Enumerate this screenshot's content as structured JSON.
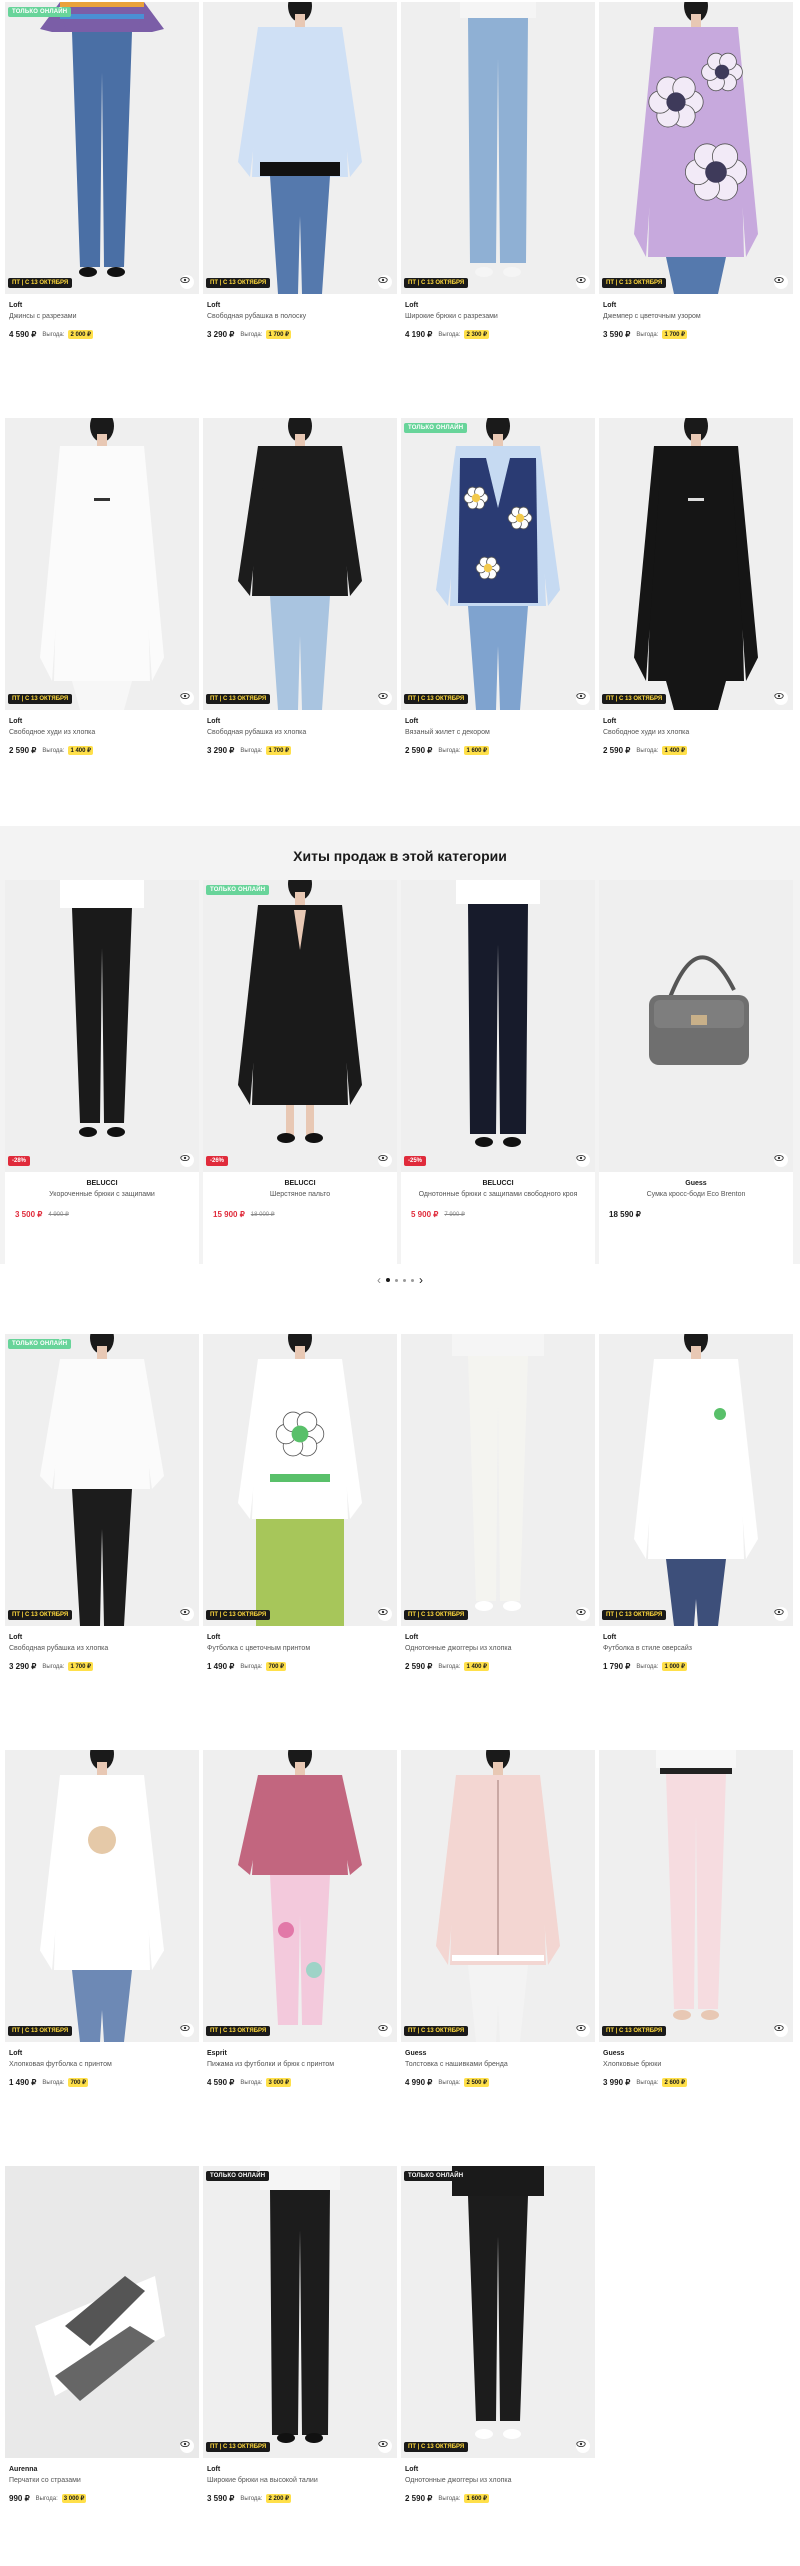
{
  "promo_badge": "ПТ | С 13 ОКТЯБРЯ",
  "online_badge": "ТОЛЬКО ОНЛАЙН",
  "save_label": "Выгода:",
  "hits_title": "Хиты продаж в этой категории",
  "rows": [
    {
      "items": [
        {
          "brand": "Loft",
          "name": "Джинсы с разрезами",
          "price": "4 590 ₽",
          "save": "2 000 ₽",
          "online": "green",
          "img": "jeans"
        },
        {
          "brand": "Loft",
          "name": "Свободная рубашка в полоску",
          "price": "3 290 ₽",
          "save": "1 700 ₽",
          "online": "",
          "img": "shirt"
        },
        {
          "brand": "Loft",
          "name": "Широкие брюки с разрезами",
          "price": "4 190 ₽",
          "save": "2 300 ₽",
          "online": "",
          "img": "widejeans"
        },
        {
          "brand": "Loft",
          "name": "Джемпер с цветочным узором",
          "price": "3 590 ₽",
          "save": "1 700 ₽",
          "online": "",
          "img": "flowers"
        }
      ]
    },
    {
      "items": [
        {
          "brand": "Loft",
          "name": "Свободное худи из хлопка",
          "price": "2 590 ₽",
          "save": "1 400 ₽",
          "online": "",
          "img": "whitehoodie"
        },
        {
          "brand": "Loft",
          "name": "Свободная рубашка из хлопка",
          "price": "3 290 ₽",
          "save": "1 700 ₽",
          "online": "",
          "img": "blackshirt"
        },
        {
          "brand": "Loft",
          "name": "Вязаный жилет с декором",
          "price": "2 590 ₽",
          "save": "1 600 ₽",
          "online": "green",
          "img": "vest"
        },
        {
          "brand": "Loft",
          "name": "Свободное худи из хлопка",
          "price": "2 590 ₽",
          "save": "1 400 ₽",
          "online": "",
          "img": "blackhoodie"
        }
      ]
    },
    {
      "items": [
        {
          "brand": "Loft",
          "name": "Свободная рубашка из хлопка",
          "price": "3 290 ₽",
          "save": "1 700 ₽",
          "online": "green",
          "img": "whiteshirt"
        },
        {
          "brand": "Loft",
          "name": "Футболка с цветочным принтом",
          "price": "1 490 ₽",
          "save": "700 ₽",
          "online": "",
          "img": "flowertee"
        },
        {
          "brand": "Loft",
          "name": "Однотонные джоггеры из хлопка",
          "price": "2 590 ₽",
          "save": "1 400 ₽",
          "online": "",
          "img": "whitejoggers"
        },
        {
          "brand": "Loft",
          "name": "Футболка в стиле оверсайз",
          "price": "1 790 ₽",
          "save": "1 000 ₽",
          "online": "",
          "img": "oversizetee"
        }
      ]
    },
    {
      "items": [
        {
          "brand": "Loft",
          "name": "Хлопковая футболка с принтом",
          "price": "1 490 ₽",
          "save": "700 ₽",
          "online": "",
          "img": "printtee"
        },
        {
          "brand": "Esprit",
          "name": "Пижама из футболки и брюк с принтом",
          "price": "4 590 ₽",
          "save": "3 000 ₽",
          "online": "",
          "img": "pajama"
        },
        {
          "brand": "Guess",
          "name": "Толстовка с нашивками бренда",
          "price": "4 990 ₽",
          "save": "2 500 ₽",
          "online": "",
          "img": "pinkjacket"
        },
        {
          "brand": "Guess",
          "name": "Хлопковые брюки",
          "price": "3 990 ₽",
          "save": "2 600 ₽",
          "online": "",
          "img": "pinkpants"
        }
      ]
    },
    {
      "items": [
        {
          "brand": "Aurenna",
          "name": "Перчатки со стразами",
          "price": "990 ₽",
          "save": "3 000 ₽",
          "online": "",
          "img": "gloves"
        },
        {
          "brand": "Loft",
          "name": "Широкие брюки на высокой талии",
          "price": "3 590 ₽",
          "save": "2 200 ₽",
          "online": "dark",
          "img": "blackpants"
        },
        {
          "brand": "Loft",
          "name": "Однотонные джоггеры из хлопка",
          "price": "2 590 ₽",
          "save": "1 600 ₽",
          "online": "dark",
          "img": "blackjoggers"
        }
      ]
    }
  ],
  "hits": [
    {
      "brand": "BELUCCI",
      "name": "Укороченные брюки с защипами",
      "price": "3 500 ₽",
      "old": "4 900 ₽",
      "disc": "-28%",
      "online": "",
      "img": "hpants1"
    },
    {
      "brand": "BELUCCI",
      "name": "Шерстяное пальто",
      "price": "15 900 ₽",
      "old": "18 000 ₽",
      "disc": "-26%",
      "online": "green",
      "img": "coat"
    },
    {
      "brand": "BELUCCI",
      "name": "Однотонные брюки с защипами свободного кроя",
      "price": "5 900 ₽",
      "old": "7 900 ₽",
      "disc": "-25%",
      "online": "",
      "img": "hpants2"
    },
    {
      "brand": "Guess",
      "name": "Сумка кросс-боди Eco Brenton",
      "price": "18 590 ₽",
      "old": "",
      "disc": "",
      "online": "",
      "img": "bag"
    }
  ],
  "colors": {
    "online": "#68d49a",
    "promo_bg": "#1a1a1a",
    "promo_text": "#ffd93c",
    "save_bg": "#ffe04a",
    "sale": "#e02b3b"
  }
}
